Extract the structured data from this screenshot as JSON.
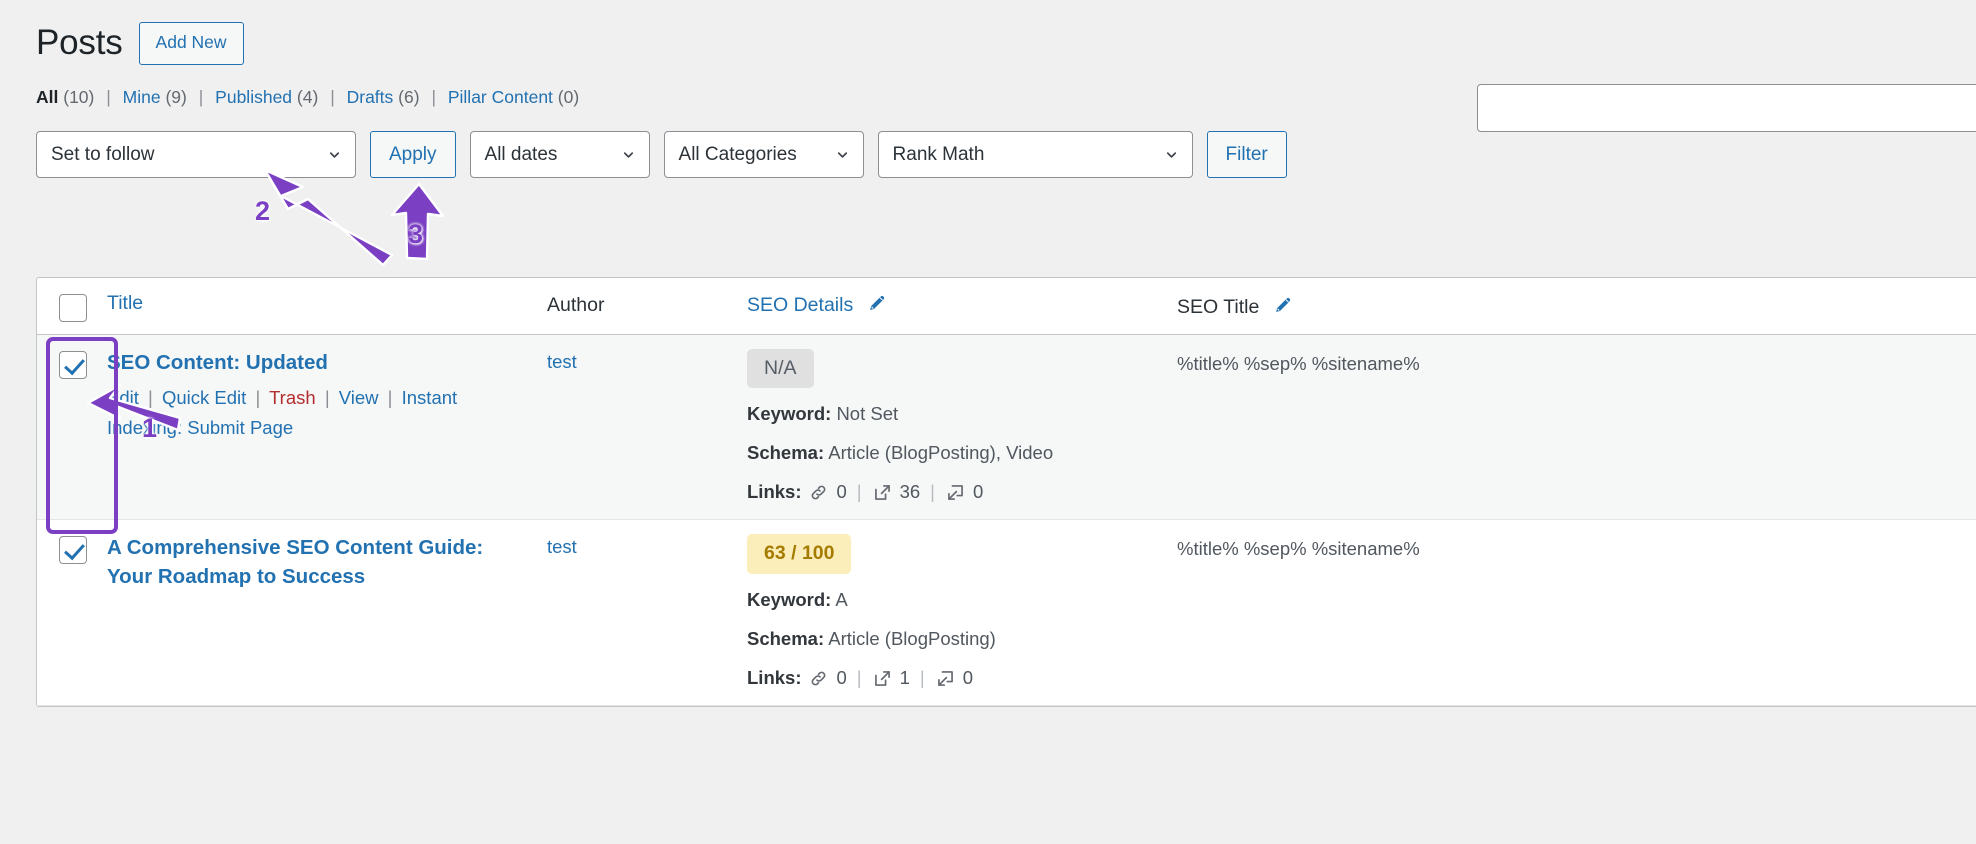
{
  "header": {
    "title": "Posts",
    "add_new_label": "Add New"
  },
  "search": {
    "value": "",
    "placeholder": ""
  },
  "status_links": [
    {
      "label": "All",
      "count": "(10)",
      "current": true
    },
    {
      "label": "Mine",
      "count": "(9)",
      "current": false
    },
    {
      "label": "Published",
      "count": "(4)",
      "current": false
    },
    {
      "label": "Drafts",
      "count": "(6)",
      "current": false
    },
    {
      "label": "Pillar Content",
      "count": "(0)",
      "current": false
    }
  ],
  "separator": "|",
  "toolbar": {
    "bulk_action": "Set to follow",
    "apply_label": "Apply",
    "dates_filter": "All dates",
    "categories_filter": "All Categories",
    "rank_math_filter": "Rank Math",
    "filter_label": "Filter"
  },
  "table": {
    "columns": {
      "title": "Title",
      "author": "Author",
      "seo_details": "SEO Details",
      "seo_title": "SEO Title"
    },
    "rows": [
      {
        "selected": true,
        "title": "SEO Content: Updated",
        "actions": {
          "edit": "Edit",
          "quick_edit": "Quick Edit",
          "trash": "Trash",
          "view": "View",
          "instant_indexing": "Instant Indexing:",
          "submit_page": "Submit Page"
        },
        "author": "test",
        "score": "N/A",
        "score_kind": "na",
        "keyword_label": "Keyword:",
        "keyword_value": "Not Set",
        "schema_label": "Schema:",
        "schema_value": "Article (BlogPosting), Video",
        "links_label": "Links:",
        "links_internal": "0",
        "links_external": "36",
        "links_incoming": "0",
        "seo_title": "%title% %sep% %sitename%"
      },
      {
        "selected": true,
        "title": "A Comprehensive SEO Content Guide: Your Roadmap to Success",
        "actions": null,
        "author": "test",
        "score": "63 / 100",
        "score_kind": "mid",
        "keyword_label": "Keyword:",
        "keyword_value": "A",
        "schema_label": "Schema:",
        "schema_value": "Article (BlogPosting)",
        "links_label": "Links:",
        "links_internal": "0",
        "links_external": "1",
        "links_incoming": "0",
        "seo_title": "%title% %sep% %sitename%"
      }
    ]
  },
  "annotations": {
    "color": "#7b3fc4",
    "markers": [
      {
        "number": "1",
        "target": "row-checkbox-column"
      },
      {
        "number": "2",
        "target": "bulk-action-select"
      },
      {
        "number": "3",
        "target": "apply-button"
      }
    ]
  },
  "colors": {
    "accent_link": "#2271b1",
    "trash_link": "#b32d2e",
    "annotation": "#7b3fc4",
    "score_mid_bg": "#fbeeba",
    "score_mid_fg": "#a57c00",
    "score_na_bg": "#e0e0e0",
    "page_bg": "#f0f0f1"
  }
}
